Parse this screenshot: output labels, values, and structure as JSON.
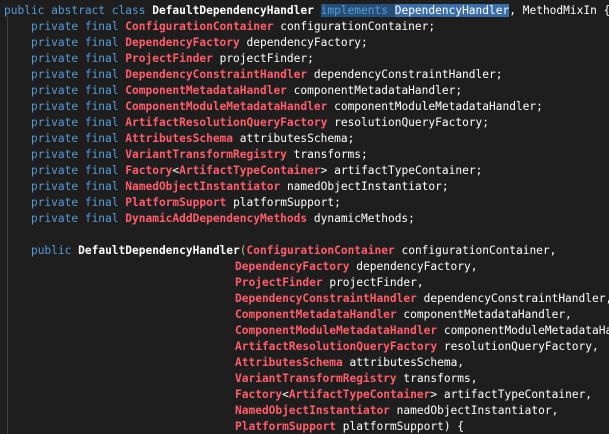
{
  "class_decl": {
    "keywords": "public abstract class",
    "name": "DefaultDependencyHandler",
    "implements_kw": "implements",
    "iface1": "DependencyHandler",
    "sep": ",",
    "iface2": "MethodMixIn",
    "brace": "{"
  },
  "field_modifier": "private final",
  "fields": [
    {
      "type": "ConfigurationContainer",
      "name": "configurationContainer;"
    },
    {
      "type": "DependencyFactory",
      "name": "dependencyFactory;"
    },
    {
      "type": "ProjectFinder",
      "name": "projectFinder;"
    },
    {
      "type": "DependencyConstraintHandler",
      "name": "dependencyConstraintHandler;"
    },
    {
      "type": "ComponentMetadataHandler",
      "name": "componentMetadataHandler;"
    },
    {
      "type": "ComponentModuleMetadataHandler",
      "name": "componentModuleMetadataHandler;"
    },
    {
      "type": "ArtifactResolutionQueryFactory",
      "name": "resolutionQueryFactory;"
    },
    {
      "type": "AttributesSchema",
      "name": "attributesSchema;"
    },
    {
      "type": "VariantTransformRegistry",
      "name": "transforms;"
    },
    {
      "type": "Factory",
      "generic_open": "<",
      "generic_type": "ArtifactTypeContainer",
      "generic_close": ">",
      "name": "artifactTypeContainer;"
    },
    {
      "type": "NamedObjectInstantiator",
      "name": "namedObjectInstantiator;"
    },
    {
      "type": "PlatformSupport",
      "name": "platformSupport;"
    },
    {
      "type": "DynamicAddDependencyMethods",
      "name": "dynamicMethods;"
    }
  ],
  "ctor": {
    "modifier": "public",
    "name": "DefaultDependencyHandler",
    "open_paren": "(",
    "params": [
      {
        "type": "ConfigurationContainer",
        "name": "configurationContainer,"
      },
      {
        "type": "DependencyFactory",
        "name": "dependencyFactory,"
      },
      {
        "type": "ProjectFinder",
        "name": "projectFinder,"
      },
      {
        "type": "DependencyConstraintHandler",
        "name": "dependencyConstraintHandler,"
      },
      {
        "type": "ComponentMetadataHandler",
        "name": "componentMetadataHandler,"
      },
      {
        "type": "ComponentModuleMetadataHandler",
        "name": "componentModuleMetadataHandl"
      },
      {
        "type": "ArtifactResolutionQueryFactory",
        "name": "resolutionQueryFactory,"
      },
      {
        "type": "AttributesSchema",
        "name": "attributesSchema,"
      },
      {
        "type": "VariantTransformRegistry",
        "name": "transforms,"
      },
      {
        "type": "Factory",
        "generic_open": "<",
        "generic_type": "ArtifactTypeContainer",
        "generic_close": ">",
        "name": "artifactTypeContainer,"
      },
      {
        "type": "NamedObjectInstantiator",
        "name": "namedObjectInstantiator,"
      },
      {
        "type": "PlatformSupport",
        "name": "platformSupport) {"
      }
    ]
  },
  "colors": {
    "background": "#1e1e1e",
    "keyword": "#569cd6",
    "type": "#ff5c6c",
    "plain": "#ffffff",
    "selection": "#264f78",
    "paren": "#d7ba7d"
  }
}
